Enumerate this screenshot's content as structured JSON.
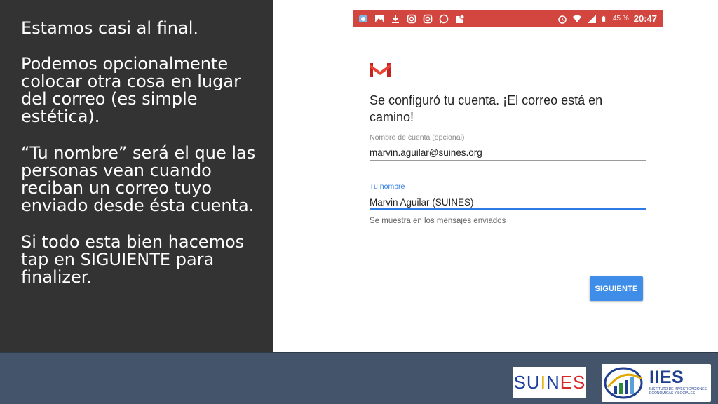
{
  "slide": {
    "paragraphs": [
      "Estamos casi al final.",
      "Podemos opcionalmente colocar otra cosa en lugar del correo (es simple estética).",
      "“Tu nombre” será el que las personas vean cuando reciban un correo tuyo enviado desde ésta cuenta.",
      "Si todo esta bien hacemos tap en SIGUIENTE para finalizer."
    ]
  },
  "statusbar": {
    "battery": "45 %",
    "time": "20:47",
    "color": "#d2463f",
    "icons_left": [
      "weather-icon",
      "gallery-icon",
      "download-icon",
      "instagram-icon",
      "instagram-icon",
      "whatsapp-icon",
      "maps-icon"
    ],
    "icons_right": [
      "alarm-icon",
      "wifi-icon",
      "signal-icon",
      "battery-icon"
    ]
  },
  "setup": {
    "heading": "Se configuró tu cuenta. ¡El correo está en camino!",
    "account_name_label": "Nombre de cuenta (opcional)",
    "account_name_value": "marvin.aguilar@suines.org",
    "your_name_label": "Tu nombre",
    "your_name_value": "Marvin Aguilar (SUINES)",
    "helper_text": "Se muestra en los mensajes enviados",
    "next_button": "SIGUIENTE",
    "accent_color": "#3d8de9"
  },
  "footer": {
    "logo_suines": {
      "part1": "SU",
      "part2": "N",
      "part3": "ES"
    },
    "logo_iies": {
      "name": "IIES",
      "subtitle": "INSTITUTO DE INVESTIGACIONES ECONÓMICAS Y SOCIALES"
    }
  }
}
